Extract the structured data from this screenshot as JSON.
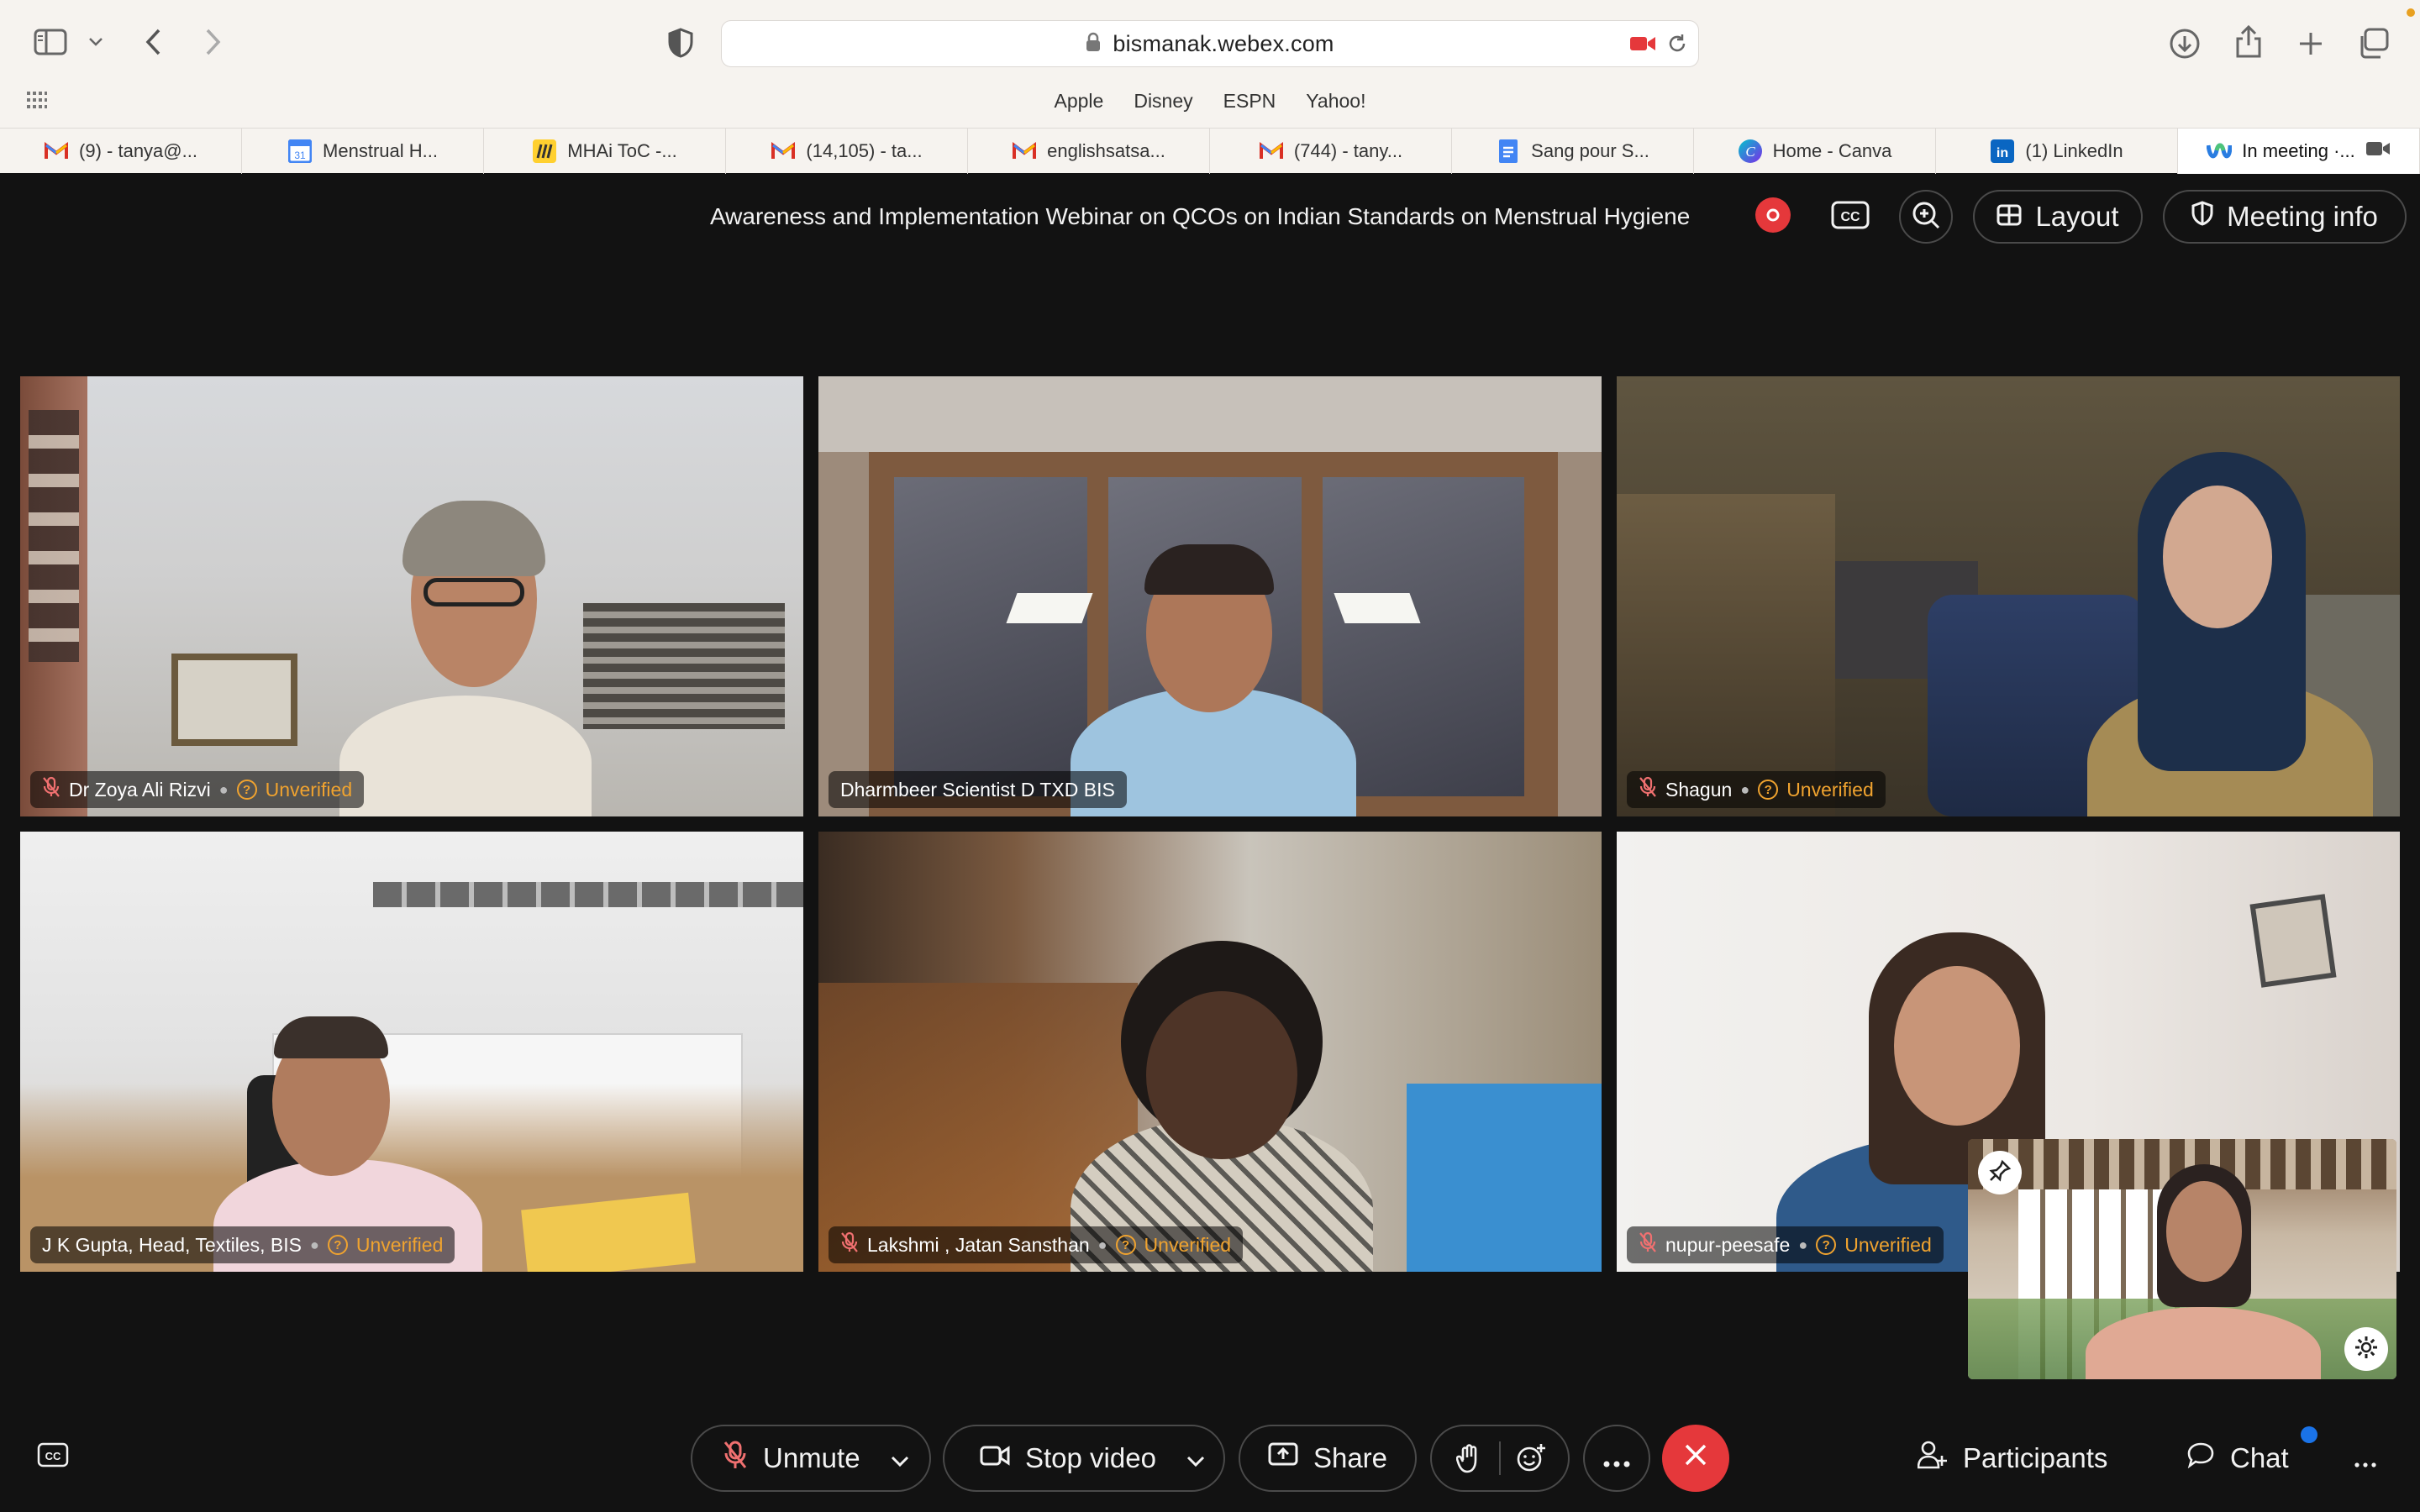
{
  "browser": {
    "url": "bismanak.webex.com",
    "favorites": [
      "Apple",
      "Disney",
      "ESPN",
      "Yahoo!"
    ],
    "tabs": [
      {
        "label": "(9) - tanya@...",
        "icon": "gmail-icon"
      },
      {
        "label": "Menstrual H...",
        "icon": "calendar-icon"
      },
      {
        "label": "MHAi ToC -...",
        "icon": "miro-icon"
      },
      {
        "label": "(14,105) - ta...",
        "icon": "gmail-icon"
      },
      {
        "label": "englishsatsa...",
        "icon": "gmail-icon"
      },
      {
        "label": "(744) - tany...",
        "icon": "gmail-icon"
      },
      {
        "label": "Sang pour S...",
        "icon": "docs-icon"
      },
      {
        "label": "Home - Canva",
        "icon": "canva-icon"
      },
      {
        "label": "(1) LinkedIn",
        "icon": "linkedin-icon"
      },
      {
        "label": "In meeting ·...",
        "icon": "webex-icon"
      }
    ]
  },
  "meeting": {
    "title": "Awareness and Implementation Webinar on QCOs on Indian Standards on Menstrual Hygiene",
    "layout_label": "Layout",
    "info_label": "Meeting info",
    "unverified_label": "Unverified"
  },
  "participants": [
    {
      "name": "Dr Zoya Ali Rizvi",
      "muted": true,
      "unverified": true
    },
    {
      "name": "Dharmbeer Scientist D TXD BIS",
      "muted": false,
      "unverified": false
    },
    {
      "name": "Shagun",
      "muted": true,
      "unverified": true
    },
    {
      "name": "J K Gupta, Head, Textiles, BIS",
      "muted": false,
      "unverified": true
    },
    {
      "name": "Lakshmi , Jatan Sansthan",
      "muted": true,
      "unverified": true
    },
    {
      "name": "nupur-peesafe",
      "muted": true,
      "unverified": true
    }
  ],
  "controls": {
    "unmute": "Unmute",
    "stop_video": "Stop video",
    "share": "Share",
    "participants": "Participants",
    "chat": "Chat"
  },
  "colors": {
    "accent_red": "#e5383b",
    "unverified": "#f0a32f",
    "chat_badge": "#1a73e8"
  }
}
